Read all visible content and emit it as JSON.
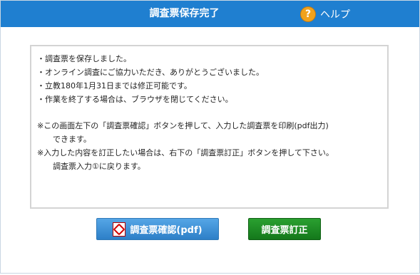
{
  "header": {
    "title": "調査票保存完了",
    "help_label": "ヘルプ",
    "help_icon_glyph": "?"
  },
  "message": {
    "bullets": [
      "・調査票を保存しました。",
      "・オンライン調査にご協力いただき、ありがとうございました。",
      "・立教180年1月31日までは修正可能です。",
      "・作業を終了する場合は、ブラウザを閉じてください。"
    ],
    "note1_line1": "※この画面左下の「調査票確認」ボタンを押して、入力した調査票を印刷(pdf出力)",
    "note1_line2": "できます。",
    "note2_line1": "※入力した内容を訂正したい場合は、右下の「調査票訂正」ボタンを押して下さい。",
    "note2_line2": "調査票入力①に戻ります。"
  },
  "buttons": {
    "confirm_pdf": "調査票確認(pdf)",
    "correct": "調査票訂正"
  },
  "colors": {
    "titlebar": "#1f7fd0",
    "pdf_button": "#2d7fc7",
    "correct_button": "#14781b",
    "help_icon": "#f1a21c"
  }
}
